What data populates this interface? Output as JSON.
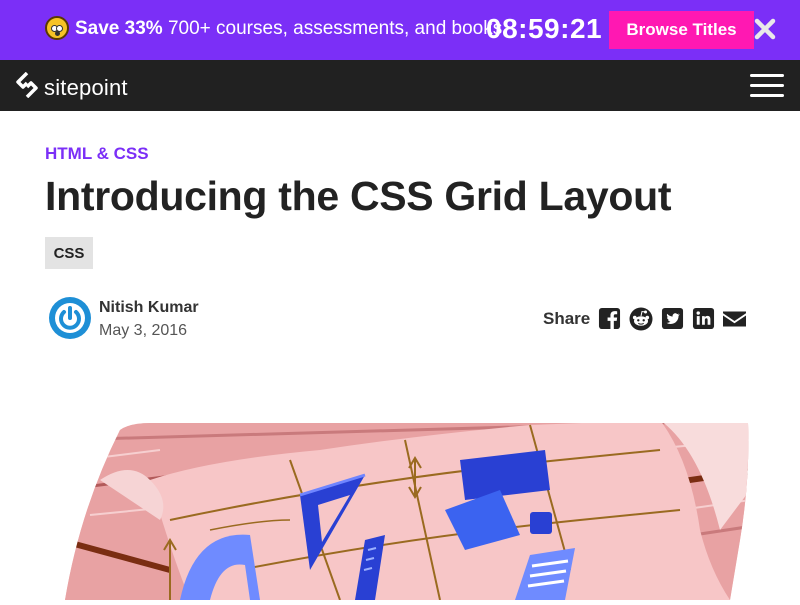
{
  "promo": {
    "highlight": "Save 33%",
    "text": " 700+ courses, assessments, and books",
    "timer": "08:59:21",
    "cta_label": "Browse Titles",
    "icons": [
      "shocked-face-emoji-icon",
      "close-icon"
    ]
  },
  "nav": {
    "logo_text": "sitepoint",
    "icons": [
      "sitepoint-logo-icon",
      "hamburger-menu-icon"
    ]
  },
  "article": {
    "category": "HTML & CSS",
    "title": "Introducing the CSS Grid Layout",
    "tag": "CSS",
    "author": {
      "name": "Nitish Kumar",
      "date": "May 3, 2016"
    },
    "share": {
      "label": "Share",
      "icons": [
        "facebook-icon",
        "reddit-icon",
        "twitter-icon",
        "linkedin-icon",
        "email-icon"
      ]
    }
  },
  "colors": {
    "promo_bg": "#7b2ff7",
    "cta_bg": "#ff18b2",
    "nav_bg": "#212121",
    "category": "#7b2ff7",
    "hero_pink": "#f4c2c4",
    "hero_blue": "#2940d3"
  }
}
